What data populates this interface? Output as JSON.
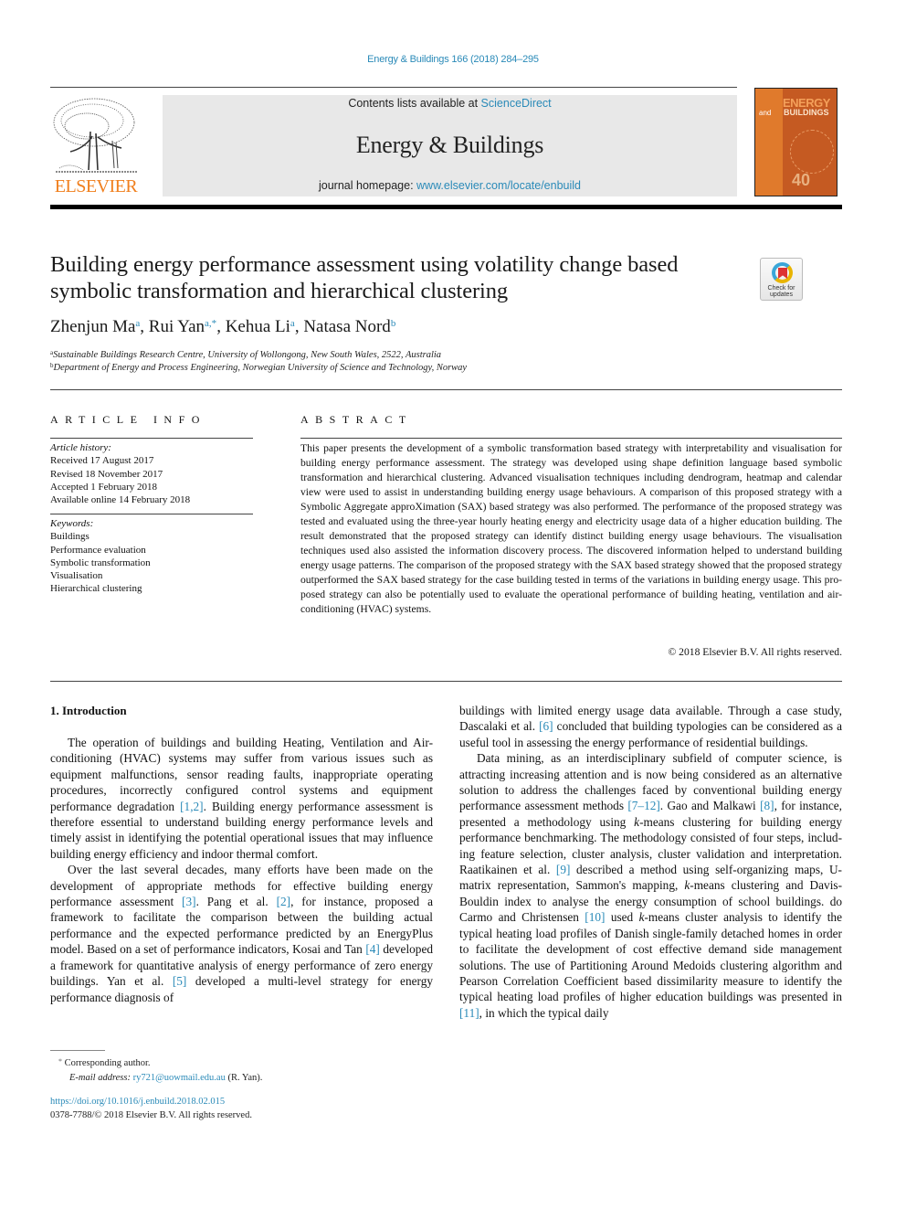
{
  "header": {
    "citation": "Energy & Buildings 166 (2018) 284–295",
    "contents_prefix": "Contents lists available at ",
    "contents_link": "ScienceDirect",
    "journal_name": "Energy & Buildings",
    "homepage_prefix": "journal homepage: ",
    "homepage_link": "www.elsevier.com/locate/enbuild",
    "publisher_logo_text": "ELSEVIER",
    "cover": {
      "title_line1": "ENERGY",
      "title_line2": "BUILDINGS",
      "and": "and",
      "anniversary": "40"
    }
  },
  "article": {
    "title": "Building energy performance assessment using volatility change based symbolic transformation and hierarchical clustering",
    "check_updates": {
      "line1": "Check for",
      "line2": "updates"
    },
    "authors": [
      {
        "name": "Zhenjun Ma",
        "sup": "a"
      },
      {
        "name": "Rui Yan",
        "sup": "a,*"
      },
      {
        "name": "Kehua Li",
        "sup": "a"
      },
      {
        "name": "Natasa Nord",
        "sup": "b"
      }
    ],
    "affiliations": [
      {
        "label": "a",
        "text": "Sustainable Buildings Research Centre, University of Wollongong, New South Wales, 2522, Australia"
      },
      {
        "label": "b",
        "text": "Department of Energy and Process Engineering, Norwegian University of Science and Technology, Norway"
      }
    ]
  },
  "article_info": {
    "heading": "ARTICLE INFO",
    "history_label": "Article history:",
    "history": [
      "Received 17 August 2017",
      "Revised 18 November 2017",
      "Accepted 1 February 2018",
      "Available online 14 February 2018"
    ],
    "keywords_label": "Keywords:",
    "keywords": [
      "Buildings",
      "Performance evaluation",
      "Symbolic transformation",
      "Visualisation",
      "Hierarchical clustering"
    ]
  },
  "abstract": {
    "heading": "ABSTRACT",
    "text": "This paper presents the development of a symbolic transformation based strategy with interpretabil­ity and visualisation for building energy performance assessment. The strategy was developed using shape definition language based symbolic transformation and hierarchical clustering. Advanced visuali­sation techniques including dendrogram, heatmap and calendar view were used to assist in understand­ing building energy usage behaviours. A comparison of this proposed strategy with a Symbolic Aggregate approXimation (SAX) based strategy was also performed. The performance of the proposed strategy was tested and evaluated using the three-year hourly heating energy and electricity usage data of a higher education building. The result demonstrated that the proposed strategy can identify distinct building en­ergy usage behaviours. The visualisation techniques used also assisted the information discovery process. The discovered information helped to understand building energy usage patterns. The comparison of the proposed strategy with the SAX based strategy showed that the proposed strategy outperformed the SAX based strategy for the case building tested in terms of the variations in building energy usage. This pro­posed strategy can also be potentially used to evaluate the operational performance of building heating, ventilation and air-conditioning (HVAC) systems.",
    "copyright": "© 2018 Elsevier B.V. All rights reserved."
  },
  "body": {
    "section_heading": "1. Introduction",
    "left_column": [
      [
        {
          "t": "The operation of buildings and building Heating, Ventilation and Air-conditioning (HVAC) systems may suffer from various is­sues such as equipment malfunctions, sensor reading faults, inap­propriate operating procedures, incorrectly configured control sys­tems and equipment performance degradation "
        },
        {
          "ref": "[1,2]"
        },
        {
          "t": ". Building en­ergy performance assessment is therefore essential to understand building energy performance levels and timely assist in identifying the potential operational issues that may influence building energy efficiency and indoor thermal comfort."
        }
      ],
      [
        {
          "t": "Over the last several decades, many efforts have been made on the development of appropriate methods for effective building en­ergy performance assessment "
        },
        {
          "ref": "[3]"
        },
        {
          "t": ". Pang et al. "
        },
        {
          "ref": "[2]"
        },
        {
          "t": ", for instance, pro­posed a framework to facilitate the comparison between the build­ing actual performance and the expected performance predicted by an EnergyPlus model. Based on a set of performance indicators, Kosai and Tan "
        },
        {
          "ref": "[4]"
        },
        {
          "t": " developed a framework for quantitative analysis of energy performance of zero energy buildings. Yan et al. "
        },
        {
          "ref": "[5]"
        },
        {
          "t": " de­veloped a multi-level strategy for energy performance diagnosis of"
        }
      ]
    ],
    "right_column": [
      [
        {
          "t": "buildings with limited energy usage data available. Through a case study, Dascalaki et al. "
        },
        {
          "ref": "[6]"
        },
        {
          "t": " concluded that building typologies can be considered as a useful tool in assessing the energy performance of residential buildings."
        }
      ],
      [
        {
          "t": "Data mining, as an interdisciplinary subfield of computer sci­ence, is attracting increasing attention and is now being consid­ered as an alternative solution to address the challenges faced by conventional building energy performance assessment methods "
        },
        {
          "ref": "[7–12]"
        },
        {
          "t": ". Gao and Malkawi "
        },
        {
          "ref": "[8]"
        },
        {
          "t": ", for instance, presented a method­ology using "
        },
        {
          "i": "k"
        },
        {
          "t": "-means clustering for building energy performance benchmarking. The methodology consisted of four steps, includ­ing feature selection, cluster analysis, cluster validation and in­terpretation. Raatikainen et al. "
        },
        {
          "ref": "[9]"
        },
        {
          "t": " described a method using self-organizing maps, U-matrix representation, Sammon's mapping, "
        },
        {
          "i": "k"
        },
        {
          "t": "-means clustering and Davis-Bouldin index to analyse the en­ergy consumption of school buildings. do Carmo and Christensen "
        },
        {
          "ref": "[10]"
        },
        {
          "t": " used "
        },
        {
          "i": "k"
        },
        {
          "t": "-means cluster analysis to identify the typical heating load profiles of Danish single-family detached homes in order to facilitate the development of cost effective demand side manage­ment solutions. The use of Partitioning Around Medoids clustering algorithm and Pearson Correlation Coefficient based dissimilarity measure to identify the typical heating load profiles of higher ed­ucation buildings was presented in "
        },
        {
          "ref": "[11]"
        },
        {
          "t": ", in which the typical daily"
        }
      ]
    ]
  },
  "footnotes": {
    "star": "*",
    "corresponding": "Corresponding author.",
    "email_label": "E-mail address:",
    "email": "ry721@uowmail.edu.au",
    "email_suffix": " (R. Yan).",
    "doi": "https://doi.org/10.1016/j.enbuild.2018.02.015",
    "issn_copyright": "0378-7788/© 2018 Elsevier B.V. All rights reserved."
  }
}
